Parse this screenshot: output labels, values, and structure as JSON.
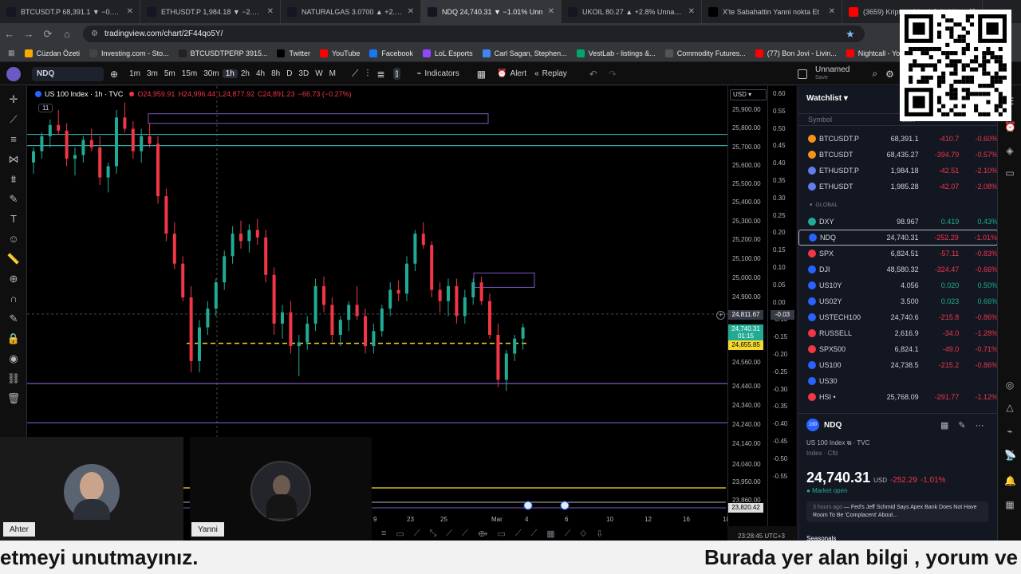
{
  "browser": {
    "tabs": [
      {
        "label": "BTCUSDT.P 68,391.1 ▼ −0.6% U",
        "icon": "tradingview-icon",
        "color": "#131722"
      },
      {
        "label": "ETHUSDT.P 1,984.18 ▼ −2.1% U",
        "icon": "tradingview-icon",
        "color": "#131722"
      },
      {
        "label": "NATURALGAS 3.0700 ▲ +2.68%",
        "icon": "tradingview-icon",
        "color": "#131722"
      },
      {
        "label": "NDQ 24,740.31 ▼ −1.01% Unn",
        "icon": "tradingview-icon",
        "color": "#131722",
        "active": true
      },
      {
        "label": "UKOIL 80.27 ▲ +2.8% Unname",
        "icon": "tradingview-icon",
        "color": "#131722"
      },
      {
        "label": "X'te Sabahattin Yanni nokta Et",
        "icon": "x-icon",
        "color": "#000000"
      },
      {
        "label": "(3659) Kriptoya Vergi Şokul Ne",
        "icon": "youtube-icon",
        "color": "#ff0000"
      }
    ],
    "url": "tradingview.com/chart/2F44qo5Y/",
    "bookmarks": [
      "Cüzdan Özeti",
      "Investing.com - Sto...",
      "BTCUSDTPERP 3915...",
      "Twitter",
      "YouTube",
      "Facebook",
      "LoL Esports",
      "Carl Sagan, Stephen...",
      "VestLab - listings &...",
      "Commodity Futures...",
      "(77) Bon Jovi - Livin...",
      "Nightcall - YouTube"
    ],
    "bookmark_colors": [
      "#f9ab00",
      "#444",
      "#222",
      "#000",
      "#ff0000",
      "#1877f2",
      "#9146ff",
      "#4285f4",
      "#00a86b",
      "#555",
      "#ff0000",
      "#ff0000"
    ]
  },
  "toolbar": {
    "symbol": "NDQ",
    "timeframes": [
      "1m",
      "3m",
      "5m",
      "15m",
      "30m",
      "1h",
      "2h",
      "4h",
      "8h",
      "D",
      "3D",
      "W",
      "M"
    ],
    "active_timeframe": "1h",
    "indicators_label": "Indicators",
    "alert_label": "Alert",
    "replay_label": "Replay",
    "layout_name": "Unnamed",
    "layout_sub": "Save"
  },
  "legend": {
    "title": "US 100 Index · 1h · TVC",
    "open": "O24,959.91",
    "high": "H24,996.44",
    "low": "L24,877.92",
    "close": "C24,891.23",
    "change": "−66.73 (−0.27%)",
    "indicator_count": "11"
  },
  "chart_data": {
    "type": "candlestick",
    "title": "US 100 Index · 1h · TVC",
    "price_ticks": [
      "25,900.00",
      "25,800.00",
      "25,700.00",
      "25,600.00",
      "25,500.00",
      "25,400.00",
      "25,300.00",
      "25,200.00",
      "25,100.00",
      "25,000.00",
      "24,900.00",
      "24,560.00",
      "24,440.00",
      "24,340.00",
      "24,240.00",
      "24,140.00",
      "24,040.00",
      "23,950.00",
      "23,860.00"
    ],
    "pct_ticks": [
      "0.60",
      "0.55",
      "0.50",
      "0.45",
      "0.40",
      "0.35",
      "0.30",
      "0.25",
      "0.20",
      "0.15",
      "0.10",
      "0.05",
      "0.00",
      "-0.10",
      "-0.15",
      "-0.20",
      "-0.25",
      "-0.30",
      "-0.35",
      "-0.40",
      "-0.45",
      "-0.50",
      "-0.55"
    ],
    "x_ticks": [
      "9",
      "23",
      "25",
      "Mar",
      "4",
      "6",
      "10",
      "12",
      "16",
      "18"
    ],
    "currency": "USD",
    "crosshair_price": "24,811.67",
    "crosshair_pct": "-0.03",
    "last_price": "24,740.31",
    "countdown": "01:15",
    "dashed_level": "24,655.85",
    "bottom_level": "23,820.42",
    "ylim": [
      23820,
      25960
    ],
    "candles": [
      [
        25620,
        25700,
        25560,
        25680
      ],
      [
        25680,
        25780,
        25640,
        25760
      ],
      [
        25760,
        25850,
        25700,
        25820
      ],
      [
        25820,
        25900,
        25770,
        25790
      ],
      [
        25790,
        25830,
        25600,
        25640
      ],
      [
        25640,
        25700,
        25550,
        25660
      ],
      [
        25660,
        25760,
        25620,
        25740
      ],
      [
        25740,
        25800,
        25680,
        25700
      ],
      [
        25700,
        25760,
        25500,
        25540
      ],
      [
        25540,
        25620,
        25460,
        25600
      ],
      [
        25600,
        25900,
        25560,
        25860
      ],
      [
        25860,
        25940,
        25780,
        25800
      ],
      [
        25800,
        25840,
        25640,
        25680
      ],
      [
        25680,
        25800,
        25620,
        25760
      ],
      [
        25760,
        25830,
        25700,
        25720
      ],
      [
        25720,
        25760,
        25400,
        25440
      ],
      [
        25440,
        25480,
        25200,
        25240
      ],
      [
        25240,
        25300,
        25050,
        25080
      ],
      [
        25080,
        25120,
        24880,
        24900
      ],
      [
        24900,
        24960,
        24500,
        24560
      ],
      [
        24560,
        24780,
        24500,
        24740
      ],
      [
        24740,
        24880,
        24700,
        24840
      ],
      [
        24840,
        25000,
        24800,
        24980
      ],
      [
        24980,
        25150,
        24940,
        25120
      ],
      [
        25120,
        25280,
        25080,
        25240
      ],
      [
        25240,
        25310,
        25160,
        25200
      ],
      [
        25200,
        25290,
        25140,
        25260
      ],
      [
        25260,
        25320,
        25180,
        25220
      ],
      [
        25220,
        25260,
        24980,
        25020
      ],
      [
        25020,
        25060,
        24700,
        24760
      ],
      [
        24760,
        24860,
        24680,
        24820
      ],
      [
        24820,
        24880,
        24600,
        24640
      ],
      [
        24640,
        24700,
        24480,
        24660
      ],
      [
        24660,
        24800,
        24620,
        24760
      ],
      [
        24760,
        25000,
        24720,
        24960
      ],
      [
        24960,
        25010,
        24820,
        24860
      ],
      [
        24860,
        24900,
        24660,
        24700
      ],
      [
        24700,
        24800,
        24640,
        24780
      ],
      [
        24780,
        24880,
        24720,
        24860
      ],
      [
        24860,
        24960,
        24780,
        24800
      ],
      [
        24800,
        24840,
        24600,
        24640
      ],
      [
        24640,
        24760,
        24600,
        24720
      ],
      [
        24720,
        24860,
        24690,
        24840
      ],
      [
        24840,
        24980,
        24800,
        24940
      ],
      [
        24940,
        24990,
        24880,
        24920
      ],
      [
        24920,
        25120,
        24880,
        25080
      ],
      [
        25080,
        25260,
        25040,
        25240
      ],
      [
        25240,
        25300,
        25160,
        25180
      ],
      [
        25180,
        25200,
        24900,
        24940
      ],
      [
        24940,
        24980,
        24820,
        24880
      ],
      [
        24880,
        25000,
        24800,
        24960
      ],
      [
        24960,
        25000,
        24760,
        24800
      ],
      [
        24800,
        24940,
        24760,
        24900
      ],
      [
        24900,
        25000,
        24860,
        24980
      ],
      [
        24980,
        25010,
        24860,
        24880
      ],
      [
        24880,
        24920,
        24680,
        24700
      ],
      [
        24700,
        24760,
        24420,
        24460
      ],
      [
        24460,
        24620,
        24400,
        24600
      ],
      [
        24600,
        24700,
        24560,
        24680
      ],
      [
        24680,
        24760,
        24620,
        24740
      ]
    ]
  },
  "watchlist": {
    "title": "Watchlist",
    "headers": [
      "Symbol",
      "Last"
    ],
    "section": "GLOBAL",
    "rows_top": [
      {
        "s": "BTCUSDT.P",
        "l": "68,391.1",
        "c": "-410.7",
        "p": "-0.60%",
        "ic": "#f7931a"
      },
      {
        "s": "BTCUSDT",
        "l": "68,435.27",
        "c": "-394.79",
        "p": "-0.57%",
        "ic": "#f7931a"
      },
      {
        "s": "ETHUSDT.P",
        "l": "1,984.18",
        "c": "-42.51",
        "p": "-2.10%",
        "ic": "#627eea"
      },
      {
        "s": "ETHUSDT",
        "l": "1,985.28",
        "c": "-42.07",
        "p": "-2.08%",
        "ic": "#627eea"
      }
    ],
    "rows_global": [
      {
        "s": "DXY",
        "l": "98.967",
        "c": "0.419",
        "p": "0.43%",
        "ic": "#22ab94",
        "pos": true
      },
      {
        "s": "NDQ",
        "l": "24,740.31",
        "c": "-252.29",
        "p": "-1.01%",
        "ic": "#2962ff",
        "sel": true
      },
      {
        "s": "SPX",
        "l": "6,824.51",
        "c": "-57.11",
        "p": "-0.83%",
        "ic": "#f23645"
      },
      {
        "s": "DJI",
        "l": "48,580.32",
        "c": "-324.47",
        "p": "-0.66%",
        "ic": "#2962ff"
      },
      {
        "s": "US10Y",
        "l": "4.056",
        "c": "0.020",
        "p": "0.50%",
        "ic": "#2962ff",
        "pos": true
      },
      {
        "s": "US02Y",
        "l": "3.500",
        "c": "0.023",
        "p": "0.66%",
        "ic": "#2962ff",
        "pos": true
      },
      {
        "s": "USTECH100",
        "l": "24,740.6",
        "c": "-215.8",
        "p": "-0.86%",
        "ic": "#2962ff"
      },
      {
        "s": "RUSSELL",
        "l": "2,616.9",
        "c": "-34.0",
        "p": "-1.28%",
        "ic": "#f23645"
      },
      {
        "s": "SPX500",
        "l": "6,824.1",
        "c": "-49.0",
        "p": "-0.71%",
        "ic": "#f23645"
      },
      {
        "s": "US100",
        "l": "24,738.5",
        "c": "-215.2",
        "p": "-0.86%",
        "ic": "#2962ff"
      },
      {
        "s": "US30",
        "l": "",
        "c": "",
        "p": "",
        "ic": "#2962ff"
      },
      {
        "s": "HSI •",
        "l": "25,768.09",
        "c": "-291.77",
        "p": "-1.12%",
        "ic": "#f23645"
      }
    ]
  },
  "detail": {
    "symbol": "NDQ",
    "name": "US 100 Index",
    "source": "TVC",
    "type": "Index · Cfd",
    "price": "24,740.31",
    "currency": "USD",
    "change": "-252.29",
    "change_pct": "-1.01%",
    "market": "Market open",
    "news_time": "3 hours ago",
    "news_text": "Fed's Jeff Schmid Says Apex Bank Does Not Have Room To Be 'Complacent' About...",
    "seasonals": "Seasonals"
  },
  "bottom_status": "23:28:45 UTC+3",
  "webcams": [
    {
      "label": "Ahter"
    },
    {
      "label": "Yanni"
    }
  ],
  "ticker": {
    "left": "etmeyi unutmayınız.",
    "right": "Burada yer alan bilgi , yorum ve"
  }
}
